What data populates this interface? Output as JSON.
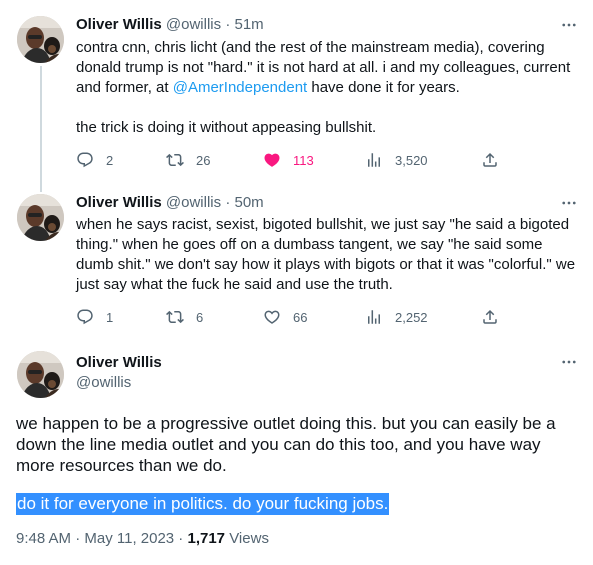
{
  "tweets": [
    {
      "display_name": "Oliver Willis",
      "handle": "@owillis",
      "separator": "·",
      "time": "51m",
      "text_before_mention": "contra cnn, chris licht (and the rest of the mainstream media), covering donald trump is not \"hard.\" it is not hard at all. i and my colleagues, current and former, at ",
      "mention": "@AmerIndependent",
      "text_after_mention": " have done it for years.",
      "paragraph2": "the trick is doing it without appeasing bullshit.",
      "actions": {
        "replies": "2",
        "retweets": "26",
        "likes": "113",
        "views": "3,520"
      },
      "liked": true
    },
    {
      "display_name": "Oliver Willis",
      "handle": "@owillis",
      "separator": "·",
      "time": "50m",
      "text": "when he says racist, sexist, bigoted bullshit, we just say \"he said a bigoted thing.\" when he goes off on a dumbass tangent, we say \"he said some dumb shit.\" we don't say how it plays with bigots or that it was \"colorful.\" we just say what the fuck he said and use the truth.",
      "actions": {
        "replies": "1",
        "retweets": "6",
        "likes": "66",
        "views": "2,252"
      },
      "liked": false
    }
  ],
  "main_tweet": {
    "display_name": "Oliver Willis",
    "handle": "@owillis",
    "text": "we happen to be a progressive outlet doing this. but you can easily be a down the line media outlet and you can do this too, and you have way more resources than we do.",
    "selected_text": "do it for everyone in politics. do your fucking jobs.",
    "timestamp": "9:48 AM · May 11, 2023 · ",
    "views_count": "1,717",
    "views_label": " Views"
  },
  "icons": {
    "more": "more-horizontal-icon",
    "reply": "reply-icon",
    "retweet": "retweet-icon",
    "like": "heart-icon",
    "views": "analytics-icon",
    "share": "share-icon"
  },
  "colors": {
    "text": "#0f1419",
    "secondary": "#536471",
    "link": "#1d9bf0",
    "like": "#f91880",
    "selection": "#3390ff",
    "thread_line": "#cfd9de"
  }
}
